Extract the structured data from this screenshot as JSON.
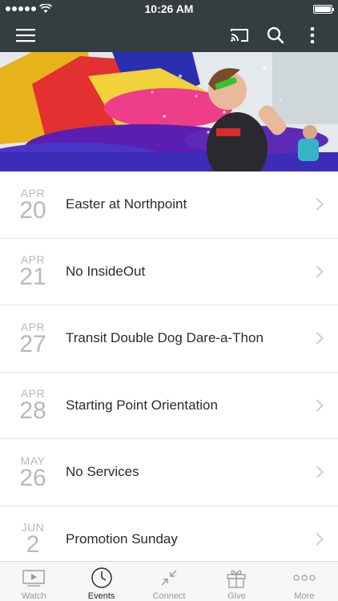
{
  "status_bar": {
    "time": "10:26 AM"
  },
  "nav": {
    "menu_icon": "hamburger-menu-icon",
    "cast_icon": "cast-icon",
    "search_icon": "search-icon",
    "more_icon": "vertical-dots-icon"
  },
  "events": [
    {
      "month": "APR",
      "day": "20",
      "title": "Easter at Northpoint"
    },
    {
      "month": "APR",
      "day": "21",
      "title": "No InsideOut"
    },
    {
      "month": "APR",
      "day": "27",
      "title": "Transit Double Dog Dare-a-Thon"
    },
    {
      "month": "APR",
      "day": "28",
      "title": "Starting Point Orientation"
    },
    {
      "month": "MAY",
      "day": "26",
      "title": "No Services"
    },
    {
      "month": "JUN",
      "day": "2",
      "title": "Promotion Sunday"
    }
  ],
  "tabs": [
    {
      "label": "Watch",
      "icon": "play-screen-icon",
      "active": false
    },
    {
      "label": "Events",
      "icon": "clock-icon",
      "active": true
    },
    {
      "label": "Connect",
      "icon": "connect-arrows-icon",
      "active": false
    },
    {
      "label": "Give",
      "icon": "gift-icon",
      "active": false
    },
    {
      "label": "More",
      "icon": "more-dots-icon",
      "active": false
    }
  ],
  "colors": {
    "nav_background": "#343d40",
    "tab_active": "#2b2b2b",
    "tab_inactive": "#9a9a9a",
    "date_text": "#b9b9b9"
  }
}
